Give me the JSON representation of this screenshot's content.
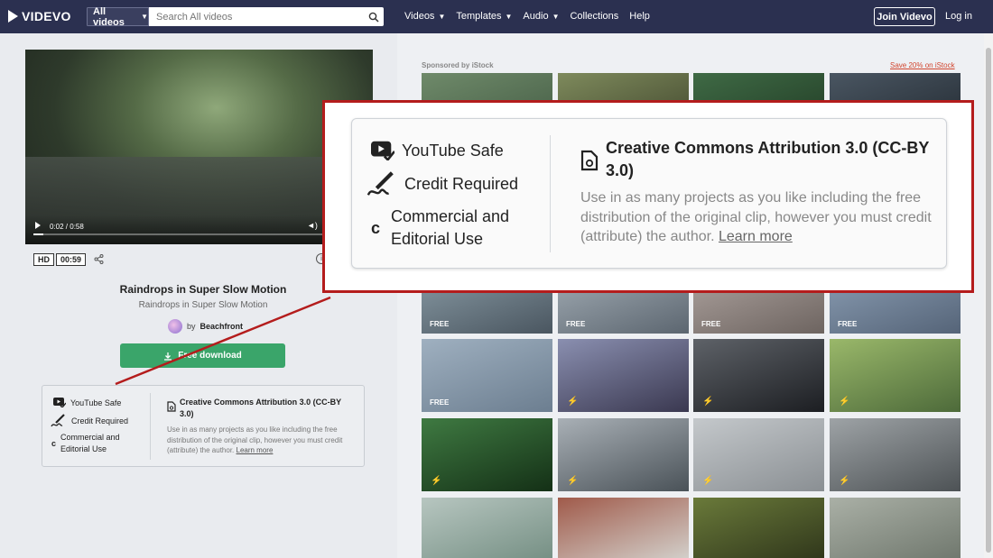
{
  "header": {
    "logo": "VIDEVO",
    "search_scope": "All videos",
    "search_placeholder": "Search All videos",
    "nav": [
      {
        "label": "Videos",
        "has_menu": true
      },
      {
        "label": "Templates",
        "has_menu": true
      },
      {
        "label": "Audio",
        "has_menu": true
      },
      {
        "label": "Collections",
        "has_menu": false
      },
      {
        "label": "Help",
        "has_menu": false
      }
    ],
    "join_label": "Join Videvo",
    "login_label": "Log in"
  },
  "player": {
    "time": "0:02 / 0:58",
    "progress": 0.035,
    "quality_badge": "HD",
    "duration_badge": "00:59"
  },
  "clip": {
    "title": "Raindrops in Super Slow Motion",
    "subtitle": "Raindrops in Super Slow Motion",
    "by_prefix": "by",
    "author": "Beachfront",
    "download_label": "Free download"
  },
  "license": {
    "youtube": "YouTube Safe",
    "credit": "Credit Required",
    "commercial_line1": "Commercial and",
    "commercial_line2": "Editorial Use",
    "name": "Creative Commons Attribution 3.0 (CC-BY 3.0)",
    "description": "Use in as many projects as you like including the free distribution of the original clip, however you must credit (attribute) the author.",
    "learn_more": "Learn more"
  },
  "grid": {
    "sponsored": "Sponsored by iStock",
    "save_offer": "Save 20% on iStock",
    "free_label": "FREE",
    "tiles": [
      {
        "c1": "#6f8a6a",
        "c2": "#3f5740",
        "tag": "none"
      },
      {
        "c1": "#7e8a5c",
        "c2": "#3a3f28",
        "tag": "none"
      },
      {
        "c1": "#3f6a45",
        "c2": "#1d3621",
        "tag": "none"
      },
      {
        "c1": "#4a5662",
        "c2": "#1e252c",
        "tag": "none"
      },
      {
        "c1": "#8ea0aa",
        "c2": "#4a5660",
        "tag": "free"
      },
      {
        "c1": "#a8b2ba",
        "c2": "#5c6670",
        "tag": "free"
      },
      {
        "c1": "#b3a8a4",
        "c2": "#6d6460",
        "tag": "free"
      },
      {
        "c1": "#8fa2b8",
        "c2": "#556478",
        "tag": "free"
      },
      {
        "c1": "#9fb0c0",
        "c2": "#6c7e90",
        "tag": "free"
      },
      {
        "c1": "#8a8fb0",
        "c2": "#3a3850",
        "tag": "bolt"
      },
      {
        "c1": "#5e6268",
        "c2": "#1c1e22",
        "tag": "bolt"
      },
      {
        "c1": "#9ab86a",
        "c2": "#4d6a3a",
        "tag": "bolt"
      },
      {
        "c1": "#3f7a42",
        "c2": "#143016",
        "tag": "bolt"
      },
      {
        "c1": "#a9b0b6",
        "c2": "#4a5258",
        "tag": "bolt"
      },
      {
        "c1": "#c4c8cb",
        "c2": "#8a8f93",
        "tag": "bolt"
      },
      {
        "c1": "#9ea3a6",
        "c2": "#4d5255",
        "tag": "bolt"
      },
      {
        "c1": "#b7c6c0",
        "c2": "#6f8a7e",
        "tag": "none"
      },
      {
        "c1": "#a05a4a",
        "c2": "#d8dcd8",
        "tag": "none"
      },
      {
        "c1": "#6a7a3a",
        "c2": "#2a3018",
        "tag": "none"
      },
      {
        "c1": "#aab0a6",
        "c2": "#6a7268",
        "tag": "none"
      }
    ]
  },
  "colors": {
    "header_bg": "#2b3050",
    "download_green": "#3aa56a",
    "callout_border": "#b41c1c",
    "offer_red": "#d1452e"
  }
}
